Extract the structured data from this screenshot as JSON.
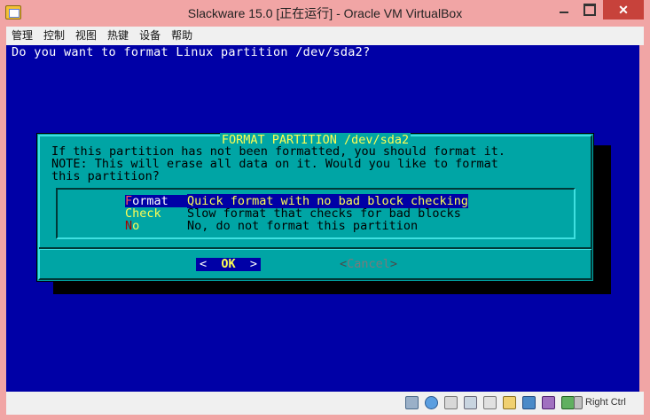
{
  "window": {
    "title": "Slackware 15.0 [正在运行] - Oracle VM VirtualBox",
    "app_icon": "virtualbox-icon",
    "controls": [
      "minimize-icon",
      "maximize-icon",
      "close-icon"
    ]
  },
  "menubar": {
    "items": [
      "管理",
      "控制",
      "视图",
      "热键",
      "设备",
      "帮助"
    ]
  },
  "guest": {
    "backtitle": "Do you want to format Linux partition /dev/sda2?",
    "dialog": {
      "title": "FORMAT PARTITION /dev/sda2",
      "lines": [
        "If this partition has not been formatted, you should format it.",
        "NOTE: This will erase all data on it. Would you like to format",
        "this partition?"
      ],
      "options": [
        {
          "hotkey": "F",
          "rest": "ormat",
          "description": "Quick format with no bad block checking",
          "selected": true
        },
        {
          "hotkey": "C",
          "rest": "heck",
          "description": "Slow format that checks for bad blocks",
          "selected": false
        },
        {
          "hotkey": "N",
          "rest": "o",
          "description": "No, do not format this partition",
          "selected": false
        }
      ],
      "ok_button": {
        "left": "<",
        "label": "OK",
        "right": ">"
      },
      "cancel_button": {
        "left": "<",
        "label": "Cancel",
        "right": ">"
      }
    },
    "colors": {
      "background": "#0000a6",
      "dialog": "#00a5a5",
      "title": "#fdfd53"
    }
  },
  "statusbar": {
    "icons": [
      "hard-disk-icon",
      "optical-drive-icon",
      "audio-icon",
      "network-icon",
      "usb-icon",
      "shared-folder-icon",
      "display-icon",
      "video-capture-icon",
      "mouse-integration-icon",
      "keyboard-icon"
    ],
    "host_key": "Right Ctrl"
  }
}
